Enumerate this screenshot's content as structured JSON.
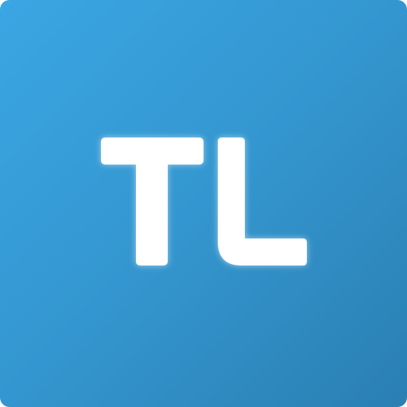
{
  "app_icon": {
    "monogram": "TL",
    "colors": {
      "gradient_start": "#3aa6e3",
      "gradient_mid": "#3496cf",
      "gradient_end": "#2a7fb2",
      "letter_fill": "#ffffff",
      "glow": "#ffffff"
    }
  }
}
